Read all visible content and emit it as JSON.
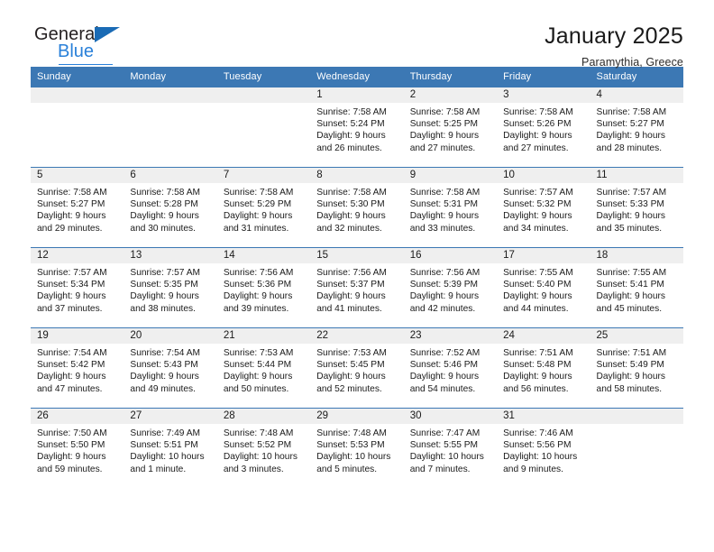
{
  "brand": {
    "word_one": "General",
    "word_two": "Blue",
    "triangle_icon": "triangle-icon"
  },
  "header": {
    "title": "January 2025",
    "subtitle": "Paramythia, Greece"
  },
  "colors": {
    "header_blue": "#3c78b4",
    "brand_blue": "#2980d9",
    "daynum_band": "#efefef",
    "text": "#1a1a1a"
  },
  "calendar": {
    "weekday_headers": [
      "Sunday",
      "Monday",
      "Tuesday",
      "Wednesday",
      "Thursday",
      "Friday",
      "Saturday"
    ],
    "weeks": [
      [
        {
          "day": "",
          "empty": true
        },
        {
          "day": "",
          "empty": true
        },
        {
          "day": "",
          "empty": true
        },
        {
          "day": "1",
          "sunrise": "Sunrise: 7:58 AM",
          "sunset": "Sunset: 5:24 PM",
          "daylight_line1": "Daylight: 9 hours",
          "daylight_line2": "and 26 minutes."
        },
        {
          "day": "2",
          "sunrise": "Sunrise: 7:58 AM",
          "sunset": "Sunset: 5:25 PM",
          "daylight_line1": "Daylight: 9 hours",
          "daylight_line2": "and 27 minutes."
        },
        {
          "day": "3",
          "sunrise": "Sunrise: 7:58 AM",
          "sunset": "Sunset: 5:26 PM",
          "daylight_line1": "Daylight: 9 hours",
          "daylight_line2": "and 27 minutes."
        },
        {
          "day": "4",
          "sunrise": "Sunrise: 7:58 AM",
          "sunset": "Sunset: 5:27 PM",
          "daylight_line1": "Daylight: 9 hours",
          "daylight_line2": "and 28 minutes."
        }
      ],
      [
        {
          "day": "5",
          "sunrise": "Sunrise: 7:58 AM",
          "sunset": "Sunset: 5:27 PM",
          "daylight_line1": "Daylight: 9 hours",
          "daylight_line2": "and 29 minutes."
        },
        {
          "day": "6",
          "sunrise": "Sunrise: 7:58 AM",
          "sunset": "Sunset: 5:28 PM",
          "daylight_line1": "Daylight: 9 hours",
          "daylight_line2": "and 30 minutes."
        },
        {
          "day": "7",
          "sunrise": "Sunrise: 7:58 AM",
          "sunset": "Sunset: 5:29 PM",
          "daylight_line1": "Daylight: 9 hours",
          "daylight_line2": "and 31 minutes."
        },
        {
          "day": "8",
          "sunrise": "Sunrise: 7:58 AM",
          "sunset": "Sunset: 5:30 PM",
          "daylight_line1": "Daylight: 9 hours",
          "daylight_line2": "and 32 minutes."
        },
        {
          "day": "9",
          "sunrise": "Sunrise: 7:58 AM",
          "sunset": "Sunset: 5:31 PM",
          "daylight_line1": "Daylight: 9 hours",
          "daylight_line2": "and 33 minutes."
        },
        {
          "day": "10",
          "sunrise": "Sunrise: 7:57 AM",
          "sunset": "Sunset: 5:32 PM",
          "daylight_line1": "Daylight: 9 hours",
          "daylight_line2": "and 34 minutes."
        },
        {
          "day": "11",
          "sunrise": "Sunrise: 7:57 AM",
          "sunset": "Sunset: 5:33 PM",
          "daylight_line1": "Daylight: 9 hours",
          "daylight_line2": "and 35 minutes."
        }
      ],
      [
        {
          "day": "12",
          "sunrise": "Sunrise: 7:57 AM",
          "sunset": "Sunset: 5:34 PM",
          "daylight_line1": "Daylight: 9 hours",
          "daylight_line2": "and 37 minutes."
        },
        {
          "day": "13",
          "sunrise": "Sunrise: 7:57 AM",
          "sunset": "Sunset: 5:35 PM",
          "daylight_line1": "Daylight: 9 hours",
          "daylight_line2": "and 38 minutes."
        },
        {
          "day": "14",
          "sunrise": "Sunrise: 7:56 AM",
          "sunset": "Sunset: 5:36 PM",
          "daylight_line1": "Daylight: 9 hours",
          "daylight_line2": "and 39 minutes."
        },
        {
          "day": "15",
          "sunrise": "Sunrise: 7:56 AM",
          "sunset": "Sunset: 5:37 PM",
          "daylight_line1": "Daylight: 9 hours",
          "daylight_line2": "and 41 minutes."
        },
        {
          "day": "16",
          "sunrise": "Sunrise: 7:56 AM",
          "sunset": "Sunset: 5:39 PM",
          "daylight_line1": "Daylight: 9 hours",
          "daylight_line2": "and 42 minutes."
        },
        {
          "day": "17",
          "sunrise": "Sunrise: 7:55 AM",
          "sunset": "Sunset: 5:40 PM",
          "daylight_line1": "Daylight: 9 hours",
          "daylight_line2": "and 44 minutes."
        },
        {
          "day": "18",
          "sunrise": "Sunrise: 7:55 AM",
          "sunset": "Sunset: 5:41 PM",
          "daylight_line1": "Daylight: 9 hours",
          "daylight_line2": "and 45 minutes."
        }
      ],
      [
        {
          "day": "19",
          "sunrise": "Sunrise: 7:54 AM",
          "sunset": "Sunset: 5:42 PM",
          "daylight_line1": "Daylight: 9 hours",
          "daylight_line2": "and 47 minutes."
        },
        {
          "day": "20",
          "sunrise": "Sunrise: 7:54 AM",
          "sunset": "Sunset: 5:43 PM",
          "daylight_line1": "Daylight: 9 hours",
          "daylight_line2": "and 49 minutes."
        },
        {
          "day": "21",
          "sunrise": "Sunrise: 7:53 AM",
          "sunset": "Sunset: 5:44 PM",
          "daylight_line1": "Daylight: 9 hours",
          "daylight_line2": "and 50 minutes."
        },
        {
          "day": "22",
          "sunrise": "Sunrise: 7:53 AM",
          "sunset": "Sunset: 5:45 PM",
          "daylight_line1": "Daylight: 9 hours",
          "daylight_line2": "and 52 minutes."
        },
        {
          "day": "23",
          "sunrise": "Sunrise: 7:52 AM",
          "sunset": "Sunset: 5:46 PM",
          "daylight_line1": "Daylight: 9 hours",
          "daylight_line2": "and 54 minutes."
        },
        {
          "day": "24",
          "sunrise": "Sunrise: 7:51 AM",
          "sunset": "Sunset: 5:48 PM",
          "daylight_line1": "Daylight: 9 hours",
          "daylight_line2": "and 56 minutes."
        },
        {
          "day": "25",
          "sunrise": "Sunrise: 7:51 AM",
          "sunset": "Sunset: 5:49 PM",
          "daylight_line1": "Daylight: 9 hours",
          "daylight_line2": "and 58 minutes."
        }
      ],
      [
        {
          "day": "26",
          "sunrise": "Sunrise: 7:50 AM",
          "sunset": "Sunset: 5:50 PM",
          "daylight_line1": "Daylight: 9 hours",
          "daylight_line2": "and 59 minutes."
        },
        {
          "day": "27",
          "sunrise": "Sunrise: 7:49 AM",
          "sunset": "Sunset: 5:51 PM",
          "daylight_line1": "Daylight: 10 hours",
          "daylight_line2": "and 1 minute."
        },
        {
          "day": "28",
          "sunrise": "Sunrise: 7:48 AM",
          "sunset": "Sunset: 5:52 PM",
          "daylight_line1": "Daylight: 10 hours",
          "daylight_line2": "and 3 minutes."
        },
        {
          "day": "29",
          "sunrise": "Sunrise: 7:48 AM",
          "sunset": "Sunset: 5:53 PM",
          "daylight_line1": "Daylight: 10 hours",
          "daylight_line2": "and 5 minutes."
        },
        {
          "day": "30",
          "sunrise": "Sunrise: 7:47 AM",
          "sunset": "Sunset: 5:55 PM",
          "daylight_line1": "Daylight: 10 hours",
          "daylight_line2": "and 7 minutes."
        },
        {
          "day": "31",
          "sunrise": "Sunrise: 7:46 AM",
          "sunset": "Sunset: 5:56 PM",
          "daylight_line1": "Daylight: 10 hours",
          "daylight_line2": "and 9 minutes."
        },
        {
          "day": "",
          "empty": true
        }
      ]
    ]
  }
}
